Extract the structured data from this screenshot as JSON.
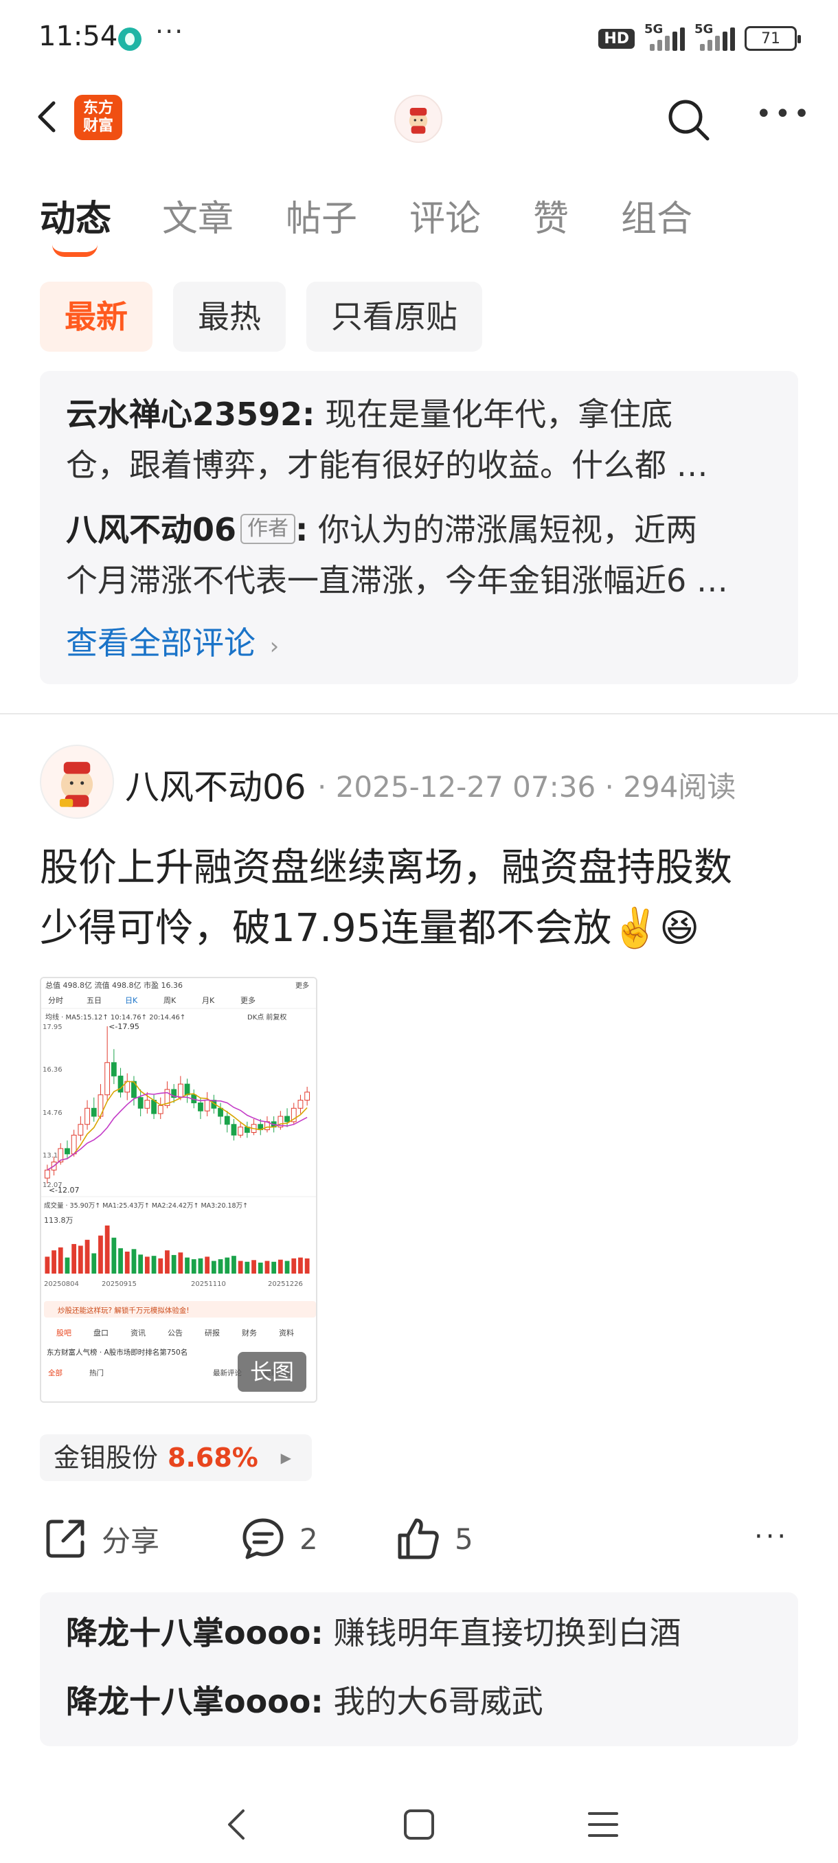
{
  "status_bar": {
    "time": "11:54",
    "more": "···",
    "hd": "HD",
    "net1": "5G",
    "net2": "5G",
    "battery": "71"
  },
  "header": {
    "logo_line1": "东方",
    "logo_line2": "财富"
  },
  "tabs": [
    {
      "label": "动态"
    },
    {
      "label": "文章"
    },
    {
      "label": "帖子"
    },
    {
      "label": "评论"
    },
    {
      "label": "赞"
    },
    {
      "label": "组合"
    }
  ],
  "filters": [
    {
      "label": "最新"
    },
    {
      "label": "最热"
    },
    {
      "label": "只看原贴"
    }
  ],
  "comments_top": [
    {
      "user": "云水禅心23592",
      "sep": ":",
      "line1": "现在是量化年代，拿住底",
      "line2": "仓，跟着博弈，才能有很好的收益。什么都 …"
    },
    {
      "user": "八风不动06",
      "tag": "作者",
      "sep": ":",
      "line1": "你认为的滞涨属短视，近两",
      "line2": "个月滞涨不代表一直滞涨，今年金钼涨幅近6 …"
    }
  ],
  "view_all": "查看全部评论",
  "post": {
    "author": "八风不动06",
    "meta": "· 2025-12-27 07:36 · 294阅读",
    "text_line1": "股价上升融资盘继续离场，融资盘持股数",
    "text_line2": "少得可怜，破17.95连量都不会放✌️😆",
    "long_badge": "长图",
    "stock_name": "金钼股份",
    "stock_pct": "8.68%",
    "stock_arrow": "▶"
  },
  "thumb": {
    "row1": "总值 498.8亿  流值 498.8亿  市盈 16.36",
    "row1_more": "更多",
    "tabs": [
      "分时",
      "五日",
      "日K",
      "周K",
      "月K",
      "更多"
    ],
    "ma_line": "均线 · MA5:15.12↑ 10:14.76↑ 20:14.46↑",
    "dk": "DK点 前复权",
    "y_labels": [
      "17.95",
      "16.36",
      "14.76",
      "13.17",
      "12.07"
    ],
    "peak_label": "<-17.95",
    "low_label": "<-12.07",
    "vol_line": "成交量 · 35.90万↑ MA1:25.43万↑ MA2:24.42万↑ MA3:20.18万↑",
    "vol_label": "113.8万",
    "dates": [
      "20250804",
      "20250915",
      "20251110",
      "20251226"
    ],
    "banner": "炒股还能这样玩? 解锁千万元模拟体验金!",
    "menu": [
      "股吧",
      "盘口",
      "资讯",
      "公告",
      "研报",
      "财务",
      "资料"
    ],
    "rank_line": "东方财富人气榜 · A股市场即时排名第750名",
    "bottom": [
      "全部",
      "热门",
      "最新评论",
      "最新发帖"
    ],
    "candles": [
      {
        "o": 12.3,
        "c": 12.6,
        "h": 12.8,
        "l": 12.1
      },
      {
        "o": 12.6,
        "c": 12.9,
        "h": 13.1,
        "l": 12.4
      },
      {
        "o": 12.9,
        "c": 13.4,
        "h": 13.6,
        "l": 12.8
      },
      {
        "o": 13.4,
        "c": 13.2,
        "h": 13.7,
        "l": 13.0
      },
      {
        "o": 13.2,
        "c": 13.9,
        "h": 14.1,
        "l": 13.1
      },
      {
        "o": 13.9,
        "c": 14.3,
        "h": 14.6,
        "l": 13.7
      },
      {
        "o": 14.3,
        "c": 14.9,
        "h": 15.2,
        "l": 14.1
      },
      {
        "o": 14.9,
        "c": 14.6,
        "h": 15.3,
        "l": 14.4
      },
      {
        "o": 14.6,
        "c": 15.4,
        "h": 15.8,
        "l": 14.5
      },
      {
        "o": 15.4,
        "c": 16.6,
        "h": 17.95,
        "l": 15.2
      },
      {
        "o": 16.6,
        "c": 16.1,
        "h": 17.1,
        "l": 15.8
      },
      {
        "o": 16.1,
        "c": 15.5,
        "h": 16.4,
        "l": 15.3
      },
      {
        "o": 15.5,
        "c": 15.9,
        "h": 16.2,
        "l": 15.2
      },
      {
        "o": 15.9,
        "c": 15.3,
        "h": 16.1,
        "l": 15.0
      },
      {
        "o": 15.3,
        "c": 14.9,
        "h": 15.6,
        "l": 14.6
      },
      {
        "o": 14.9,
        "c": 15.2,
        "h": 15.5,
        "l": 14.7
      },
      {
        "o": 15.2,
        "c": 14.7,
        "h": 15.4,
        "l": 14.5
      },
      {
        "o": 14.7,
        "c": 15.0,
        "h": 15.3,
        "l": 14.5
      },
      {
        "o": 15.0,
        "c": 15.6,
        "h": 15.9,
        "l": 14.9
      },
      {
        "o": 15.6,
        "c": 15.3,
        "h": 15.8,
        "l": 15.1
      },
      {
        "o": 15.3,
        "c": 15.8,
        "h": 16.1,
        "l": 15.2
      },
      {
        "o": 15.8,
        "c": 15.4,
        "h": 16.0,
        "l": 15.1
      },
      {
        "o": 15.4,
        "c": 15.1,
        "h": 15.6,
        "l": 14.9
      },
      {
        "o": 15.1,
        "c": 14.8,
        "h": 15.3,
        "l": 14.5
      },
      {
        "o": 14.8,
        "c": 15.2,
        "h": 15.5,
        "l": 14.6
      },
      {
        "o": 15.2,
        "c": 14.9,
        "h": 15.4,
        "l": 14.7
      },
      {
        "o": 14.9,
        "c": 14.6,
        "h": 15.1,
        "l": 14.3
      },
      {
        "o": 14.6,
        "c": 14.3,
        "h": 14.8,
        "l": 14.0
      },
      {
        "o": 14.3,
        "c": 13.9,
        "h": 14.5,
        "l": 13.7
      },
      {
        "o": 13.9,
        "c": 14.2,
        "h": 14.4,
        "l": 13.8
      },
      {
        "o": 14.2,
        "c": 14.0,
        "h": 14.4,
        "l": 13.8
      },
      {
        "o": 14.0,
        "c": 14.3,
        "h": 14.5,
        "l": 13.9
      },
      {
        "o": 14.3,
        "c": 14.1,
        "h": 14.5,
        "l": 13.9
      },
      {
        "o": 14.1,
        "c": 14.4,
        "h": 14.6,
        "l": 14.0
      },
      {
        "o": 14.4,
        "c": 14.2,
        "h": 14.6,
        "l": 14.0
      },
      {
        "o": 14.2,
        "c": 14.6,
        "h": 14.8,
        "l": 14.1
      },
      {
        "o": 14.6,
        "c": 14.4,
        "h": 14.9,
        "l": 14.2
      },
      {
        "o": 14.4,
        "c": 14.9,
        "h": 15.1,
        "l": 14.3
      },
      {
        "o": 14.9,
        "c": 15.2,
        "h": 15.4,
        "l": 14.7
      },
      {
        "o": 15.2,
        "c": 15.5,
        "h": 15.7,
        "l": 15.0
      }
    ],
    "volumes": [
      40,
      55,
      62,
      38,
      70,
      66,
      80,
      48,
      90,
      113.8,
      85,
      60,
      52,
      58,
      45,
      40,
      42,
      36,
      55,
      44,
      50,
      38,
      34,
      36,
      40,
      30,
      34,
      38,
      42,
      30,
      28,
      32,
      26,
      30,
      28,
      33,
      30,
      36,
      38,
      35.9
    ]
  },
  "actions": {
    "share": "分享",
    "comments": "2",
    "likes": "5",
    "more": "···"
  },
  "comments_bottom": [
    {
      "user": "降龙十八掌oooo",
      "sep": ":",
      "text": "赚钱明年直接切换到白酒"
    },
    {
      "user": "降龙十八掌oooo",
      "sep": ":",
      "text": "我的大6哥威武"
    }
  ],
  "colors": {
    "accent": "#ff5a1f",
    "link": "#1a73c8",
    "up_red": "#e8451e",
    "candle_up": "#e23c2f",
    "candle_down": "#1aa34a"
  }
}
